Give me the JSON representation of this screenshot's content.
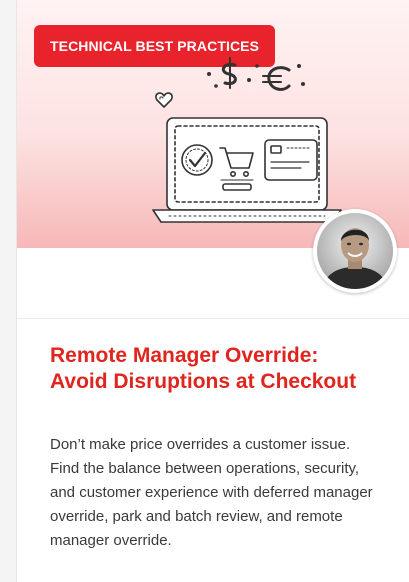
{
  "card": {
    "category_label": "TECHNICAL BEST PRACTICES",
    "title": "Remote Manager Override: Avoid Disruptions at Checkout",
    "summary": "Don’t make price overrides a customer issue. Find the balance between operations, security, and customer experience with deferred manager override, park and batch review, and remote manager override."
  },
  "icons": {
    "hero_illustration": "laptop-checkout-illustration",
    "avatar": "author-avatar"
  },
  "colors": {
    "accent": "#e8232b",
    "title": "#e0241e",
    "body_text": "#3a3a3a",
    "hero_gradient_top": "#fff3f3",
    "hero_gradient_bottom": "#f7b8b8"
  }
}
